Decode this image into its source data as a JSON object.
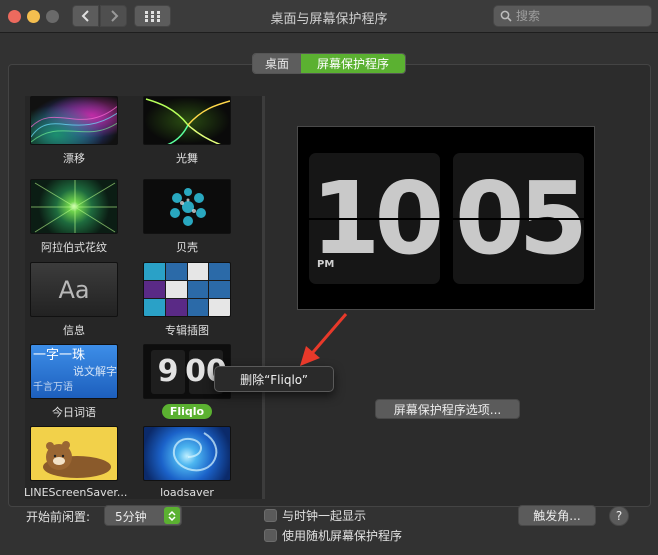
{
  "window": {
    "title": "桌面与屏幕保护程序",
    "search_placeholder": "搜索"
  },
  "tabs": [
    {
      "label": "桌面",
      "selected": false
    },
    {
      "label": "屏幕保护程序",
      "selected": true
    }
  ],
  "savers": [
    {
      "label": "漂移",
      "icon": "drift-thumbnail"
    },
    {
      "label": "光舞",
      "icon": "flurry-thumbnail"
    },
    {
      "label": "阿拉伯式花纹",
      "icon": "arabesque-thumbnail"
    },
    {
      "label": "贝壳",
      "icon": "shell-thumbnail"
    },
    {
      "label": "信息",
      "icon": "message-thumbnail",
      "thumb_text": "Aa"
    },
    {
      "label": "专辑插图",
      "icon": "album-artwork-thumbnail"
    },
    {
      "label": "今日词语",
      "icon": "word-of-the-day-thumbnail",
      "thumb_lines": [
        "一字一珠",
        "说文解字",
        "千言万语"
      ]
    },
    {
      "label": "Fliqlo",
      "icon": "fliqlo-thumbnail",
      "selected": true,
      "thumb_digits": [
        "9",
        "00"
      ]
    },
    {
      "label": "LINEScreenSaver...",
      "icon": "line-bear-thumbnail"
    },
    {
      "label": "loadsaver",
      "icon": "loadsaver-thumbnail"
    }
  ],
  "context_menu": {
    "item": "删除“Fliqlo”"
  },
  "preview": {
    "hours": "10",
    "minutes": "05",
    "ampm": "PM"
  },
  "options_button": "屏幕保护程序选项...",
  "idle": {
    "label": "开始前闲置:",
    "value": "5分钟"
  },
  "checkboxes": [
    {
      "label": "与时钟一起显示",
      "checked": false
    },
    {
      "label": "使用随机屏幕保护程序",
      "checked": false
    }
  ],
  "hot_corners_button": "触发角...",
  "help_button": "?",
  "colors": {
    "accent": "#5bb131",
    "annotation_arrow": "#e8392a"
  }
}
